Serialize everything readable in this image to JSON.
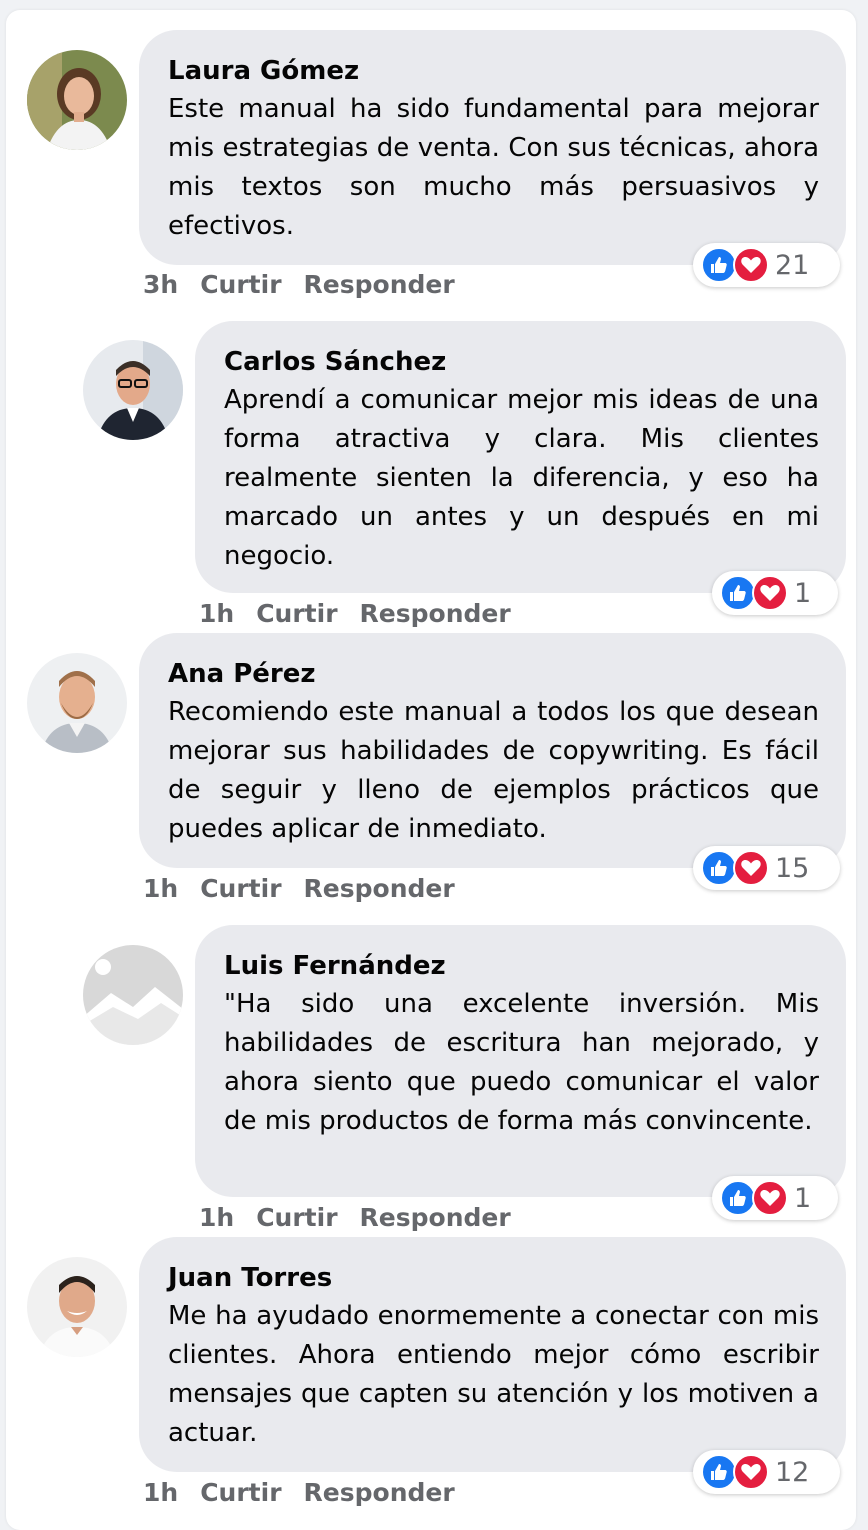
{
  "comments": [
    {
      "name": "Laura Gómez",
      "text": "Este manual ha sido fundamental para mejorar mis estrategias de venta. Con sus técnicas, ahora mis textos son mucho más persuasivos y efectivos.",
      "time": "3h",
      "like_label": "Curtir",
      "reply_label": "Responder",
      "reaction_count": "21",
      "avatar": "woman-portrait"
    },
    {
      "name": "Carlos Sánchez",
      "text": "Aprendí a comunicar mejor mis ideas de una forma atractiva y clara. Mis clientes realmente sienten la diferencia, y eso ha marcado un antes y un después en mi negocio.",
      "time": "1h",
      "like_label": "Curtir",
      "reply_label": "Responder",
      "reaction_count": "1",
      "avatar": "man-glasses-portrait"
    },
    {
      "name": "Ana Pérez",
      "text": "Recomiendo este manual a todos los que desean mejorar sus habilidades de copywriting. Es fácil de seguir y lleno de ejemplos prácticos que puedes aplicar de inmediato.",
      "time": "1h",
      "like_label": "Curtir",
      "reply_label": "Responder",
      "reaction_count": "15",
      "avatar": "man-beard-portrait"
    },
    {
      "name": "Luis Fernández",
      "text": "\"Ha sido una excelente inversión. Mis habilidades de escritura han mejorado, y ahora siento que puedo comunicar el valor de mis productos de forma más convincente.",
      "time": "1h",
      "like_label": "Curtir",
      "reply_label": "Responder",
      "reaction_count": "1",
      "avatar": "placeholder-image"
    },
    {
      "name": "Juan Torres",
      "text": "Me ha ayudado enormemente a conectar con mis clientes. Ahora entiendo mejor cómo escribir mensajes que capten su atención y los motiven a actuar.",
      "time": "1h",
      "like_label": "Curtir",
      "reply_label": "Responder",
      "reaction_count": "12",
      "avatar": "man-smiling-portrait"
    }
  ],
  "colors": {
    "bubble": "#e9eaee",
    "like_blue": "#1877f2",
    "love_red": "#e41e3f",
    "meta_gray": "#65676b"
  }
}
